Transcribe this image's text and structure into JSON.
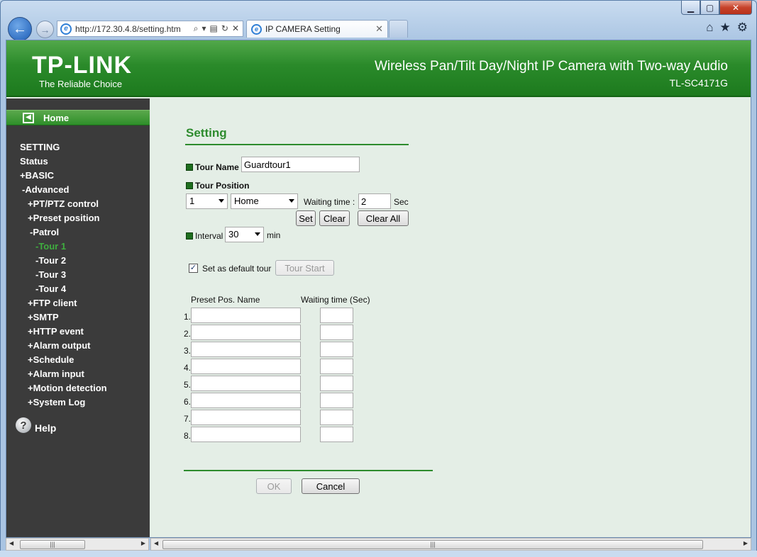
{
  "browser": {
    "url": "http://172.30.4.8/setting.htm",
    "tab_title": "IP CAMERA Setting",
    "window_controls": [
      "minimize-icon",
      "maximize-icon",
      "close-icon"
    ],
    "toolbar_icons": [
      "home-icon",
      "favorites-icon",
      "gear-icon"
    ]
  },
  "header": {
    "logo_text": "TP-LINK",
    "tagline": "The Reliable Choice",
    "product_title": "Wireless Pan/Tilt Day/Night IP Camera with Two-way Audio",
    "model": "TL-SC4171G"
  },
  "sidebar": {
    "home_label": "Home",
    "items": [
      {
        "label": "SETTING",
        "indent": 0,
        "active": false
      },
      {
        "label": "Status",
        "indent": 0,
        "active": false
      },
      {
        "label": "+BASIC",
        "indent": 1,
        "active": false
      },
      {
        "label": "-Advanced",
        "indent": 1,
        "active": false
      },
      {
        "label": "+PT/PTZ control",
        "indent": 2,
        "active": false
      },
      {
        "label": "+Preset position",
        "indent": 2,
        "active": false
      },
      {
        "label": "-Patrol",
        "indent": 2,
        "active": false
      },
      {
        "label": "-Tour 1",
        "indent": 3,
        "active": true
      },
      {
        "label": "-Tour 2",
        "indent": 3,
        "active": false
      },
      {
        "label": "-Tour 3",
        "indent": 3,
        "active": false
      },
      {
        "label": "-Tour 4",
        "indent": 3,
        "active": false
      },
      {
        "label": "+FTP client",
        "indent": 2,
        "active": false
      },
      {
        "label": "+SMTP",
        "indent": 2,
        "active": false
      },
      {
        "label": "+HTTP event",
        "indent": 2,
        "active": false
      },
      {
        "label": "+Alarm output",
        "indent": 2,
        "active": false
      },
      {
        "label": "+Schedule",
        "indent": 2,
        "active": false
      },
      {
        "label": "+Alarm input",
        "indent": 2,
        "active": false
      },
      {
        "label": "+Motion detection",
        "indent": 2,
        "active": false
      },
      {
        "label": "+System Log",
        "indent": 2,
        "active": false
      }
    ],
    "help_label": "Help"
  },
  "form": {
    "title": "Setting",
    "tour_name_label": "Tour Name",
    "tour_name_value": "Guardtour1",
    "tour_position_label": "Tour Position",
    "position_select": "1",
    "preset_select": "Home",
    "waiting_time_label": "Waiting time :",
    "waiting_time_value": "2",
    "sec_label": "Sec",
    "set_button": "Set",
    "clear_button": "Clear",
    "clear_all_button": "Clear All",
    "interval_label": "Interval",
    "interval_select": "30",
    "min_label": "min",
    "default_tour_label": "Set as default tour",
    "default_tour_checked": true,
    "tour_start_button": "Tour Start",
    "col_preset_name": "Preset Pos. Name",
    "col_waiting_time": "Waiting time (Sec)",
    "rows": [
      {
        "num": "1.",
        "name": "",
        "time": ""
      },
      {
        "num": "2.",
        "name": "",
        "time": ""
      },
      {
        "num": "3.",
        "name": "",
        "time": ""
      },
      {
        "num": "4.",
        "name": "",
        "time": ""
      },
      {
        "num": "5.",
        "name": "",
        "time": ""
      },
      {
        "num": "6.",
        "name": "",
        "time": ""
      },
      {
        "num": "7.",
        "name": "",
        "time": ""
      },
      {
        "num": "8.",
        "name": "",
        "time": ""
      }
    ],
    "ok_button": "OK",
    "cancel_button": "Cancel"
  },
  "colors": {
    "brand_green": "#2d8b2d",
    "sidebar_bg": "#3b3b3b",
    "content_bg": "#e4eee6",
    "active_item": "#3fae3f"
  }
}
